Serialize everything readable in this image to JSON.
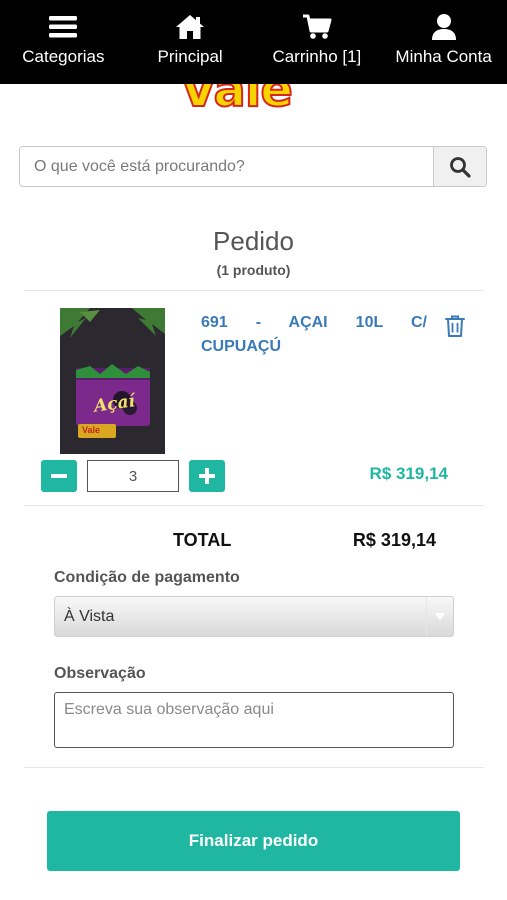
{
  "nav": {
    "items": [
      {
        "label": "Categorias",
        "icon": "menu-icon"
      },
      {
        "label": "Principal",
        "icon": "home-icon"
      },
      {
        "label": "Carrinho [1]",
        "icon": "cart-icon"
      },
      {
        "label": "Minha Conta",
        "icon": "user-icon"
      }
    ]
  },
  "logo": {
    "text": "Vale"
  },
  "search": {
    "placeholder": "O que você está procurando?"
  },
  "order": {
    "title": "Pedido",
    "subtitle": "(1 produto)",
    "item": {
      "name": "691 - AÇAI 10L C/ CUPUAÇÚ",
      "package_text": "Açaí",
      "brand_text": "Vale",
      "quantity": "3",
      "price": "R$ 319,14"
    },
    "total_label": "TOTAL",
    "total_value": "R$ 319,14"
  },
  "payment": {
    "label": "Condição de pagamento",
    "selected": "À Vista"
  },
  "observation": {
    "label": "Observação",
    "placeholder": "Escreva sua observação aqui"
  },
  "actions": {
    "finalize_label": "Finalizar pedido"
  },
  "colors": {
    "accent": "#1fb7a1",
    "link": "#3a7ab8",
    "nav_bg": "#000000",
    "logo_yellow": "#f7d400",
    "logo_red": "#d6271f"
  }
}
